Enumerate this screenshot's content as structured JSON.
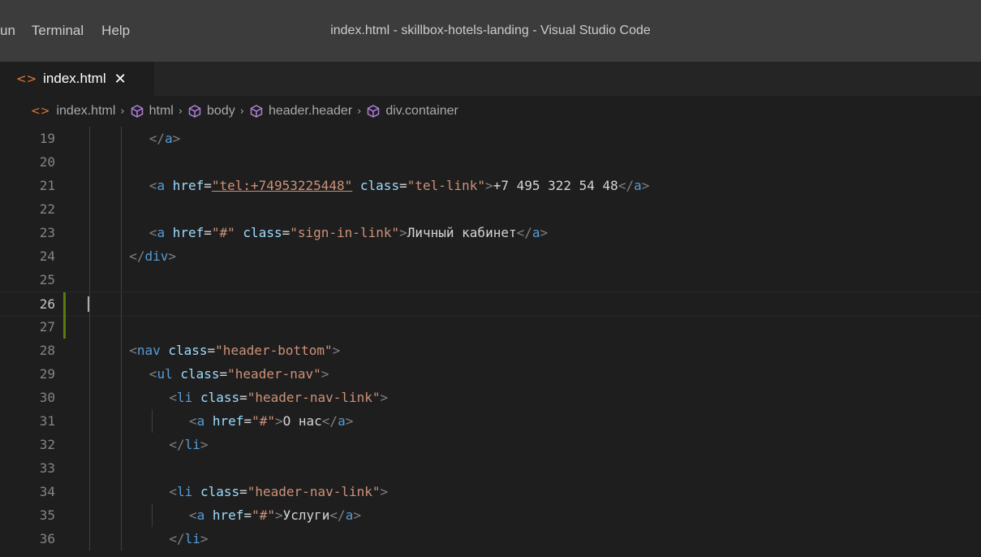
{
  "menu": {
    "items": [
      "un",
      "Terminal",
      "Help"
    ]
  },
  "window_title": "index.html - skillbox-hotels-landing - Visual Studio Code",
  "tab": {
    "label": "index.html",
    "close": "✕"
  },
  "breadcrumb": {
    "file": "index.html",
    "items": [
      "html",
      "body",
      "header.header",
      "div.container"
    ]
  },
  "editor": {
    "active_line": "26",
    "lines": [
      {
        "num": "19",
        "indent": 6,
        "tokens": [
          [
            "punc",
            "</"
          ],
          [
            "tag",
            "a"
          ],
          [
            "punc",
            ">"
          ]
        ]
      },
      {
        "num": "20",
        "indent": 0,
        "tokens": []
      },
      {
        "num": "21",
        "indent": 6,
        "tokens": [
          [
            "punc",
            "<"
          ],
          [
            "tag",
            "a "
          ],
          [
            "attr",
            "href"
          ],
          [
            "txt",
            "="
          ],
          [
            "strlink",
            "\"tel:+74953225448\""
          ],
          [
            "txt",
            " "
          ],
          [
            "attr",
            "class"
          ],
          [
            "txt",
            "="
          ],
          [
            "str",
            "\"tel-link\""
          ],
          [
            "punc",
            ">"
          ],
          [
            "txt",
            "+7 495 322 54 48"
          ],
          [
            "punc",
            "</"
          ],
          [
            "tag",
            "a"
          ],
          [
            "punc",
            ">"
          ]
        ]
      },
      {
        "num": "22",
        "indent": 0,
        "tokens": []
      },
      {
        "num": "23",
        "indent": 6,
        "tokens": [
          [
            "punc",
            "<"
          ],
          [
            "tag",
            "a "
          ],
          [
            "attr",
            "href"
          ],
          [
            "txt",
            "="
          ],
          [
            "str",
            "\"#\""
          ],
          [
            "txt",
            " "
          ],
          [
            "attr",
            "class"
          ],
          [
            "txt",
            "="
          ],
          [
            "str",
            "\"sign-in-link\""
          ],
          [
            "punc",
            ">"
          ],
          [
            "txt",
            "Личный кабинет"
          ],
          [
            "punc",
            "</"
          ],
          [
            "tag",
            "a"
          ],
          [
            "punc",
            ">"
          ]
        ]
      },
      {
        "num": "24",
        "indent": 4,
        "tokens": [
          [
            "punc",
            "</"
          ],
          [
            "tag",
            "div"
          ],
          [
            "punc",
            ">"
          ]
        ]
      },
      {
        "num": "25",
        "indent": 0,
        "tokens": []
      },
      {
        "num": "26",
        "indent": 0,
        "tokens": []
      },
      {
        "num": "27",
        "indent": 0,
        "tokens": []
      },
      {
        "num": "28",
        "indent": 4,
        "tokens": [
          [
            "punc",
            "<"
          ],
          [
            "tag",
            "nav "
          ],
          [
            "attr",
            "class"
          ],
          [
            "txt",
            "="
          ],
          [
            "str",
            "\"header-bottom\""
          ],
          [
            "punc",
            ">"
          ]
        ]
      },
      {
        "num": "29",
        "indent": 6,
        "tokens": [
          [
            "punc",
            "<"
          ],
          [
            "tag",
            "ul "
          ],
          [
            "attr",
            "class"
          ],
          [
            "txt",
            "="
          ],
          [
            "str",
            "\"header-nav\""
          ],
          [
            "punc",
            ">"
          ]
        ]
      },
      {
        "num": "30",
        "indent": 8,
        "tokens": [
          [
            "punc",
            "<"
          ],
          [
            "tag",
            "li "
          ],
          [
            "attr",
            "class"
          ],
          [
            "txt",
            "="
          ],
          [
            "str",
            "\"header-nav-link\""
          ],
          [
            "punc",
            ">"
          ]
        ]
      },
      {
        "num": "31",
        "indent": 10,
        "tokens": [
          [
            "punc",
            "<"
          ],
          [
            "tag",
            "a "
          ],
          [
            "attr",
            "href"
          ],
          [
            "txt",
            "="
          ],
          [
            "str",
            "\"#\""
          ],
          [
            "punc",
            ">"
          ],
          [
            "txt",
            "О нас"
          ],
          [
            "punc",
            "</"
          ],
          [
            "tag",
            "a"
          ],
          [
            "punc",
            ">"
          ]
        ]
      },
      {
        "num": "32",
        "indent": 8,
        "tokens": [
          [
            "punc",
            "</"
          ],
          [
            "tag",
            "li"
          ],
          [
            "punc",
            ">"
          ]
        ]
      },
      {
        "num": "33",
        "indent": 0,
        "tokens": []
      },
      {
        "num": "34",
        "indent": 8,
        "tokens": [
          [
            "punc",
            "<"
          ],
          [
            "tag",
            "li "
          ],
          [
            "attr",
            "class"
          ],
          [
            "txt",
            "="
          ],
          [
            "str",
            "\"header-nav-link\""
          ],
          [
            "punc",
            ">"
          ]
        ]
      },
      {
        "num": "35",
        "indent": 10,
        "tokens": [
          [
            "punc",
            "<"
          ],
          [
            "tag",
            "a "
          ],
          [
            "attr",
            "href"
          ],
          [
            "txt",
            "="
          ],
          [
            "str",
            "\"#\""
          ],
          [
            "punc",
            ">"
          ],
          [
            "txt",
            "Услуги"
          ],
          [
            "punc",
            "</"
          ],
          [
            "tag",
            "a"
          ],
          [
            "punc",
            ">"
          ]
        ]
      },
      {
        "num": "36",
        "indent": 8,
        "tokens": [
          [
            "punc",
            "</"
          ],
          [
            "tag",
            "li"
          ],
          [
            "punc",
            ">"
          ]
        ]
      }
    ]
  }
}
